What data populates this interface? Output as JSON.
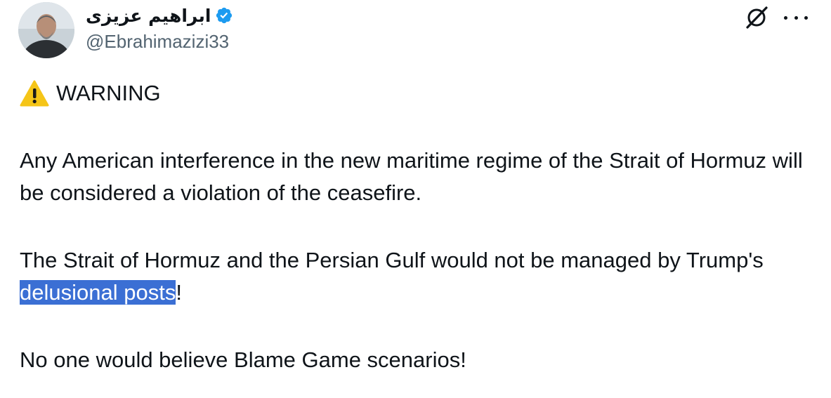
{
  "author": {
    "display_name": "ابراهیم عزیزی",
    "handle": "@Ebrahimazizi33",
    "verified_icon": "verified-badge-icon",
    "avatar_icon": "avatar"
  },
  "header_actions": {
    "grok_icon": "grok-icon",
    "more_icon": "more-icon"
  },
  "tweet": {
    "warning_emoji": "warning-icon",
    "warning_label": "WARNING",
    "paragraph_1": "Any American interference in the new maritime regime of the Strait of Hormuz will be considered a violation of the ceasefire.",
    "paragraph_2_before": "The Strait of Hormuz and the Persian Gulf would not be managed by Trump's ",
    "paragraph_2_highlight": "delusional posts",
    "paragraph_2_after": "!",
    "paragraph_3": "No one would believe Blame Game scenarios!"
  },
  "colors": {
    "text": "#0f1419",
    "secondary_text": "#536471",
    "verified_blue": "#1d9bf0",
    "selection_highlight": "#3b6fd4",
    "warning_yellow": "#f5c518"
  }
}
